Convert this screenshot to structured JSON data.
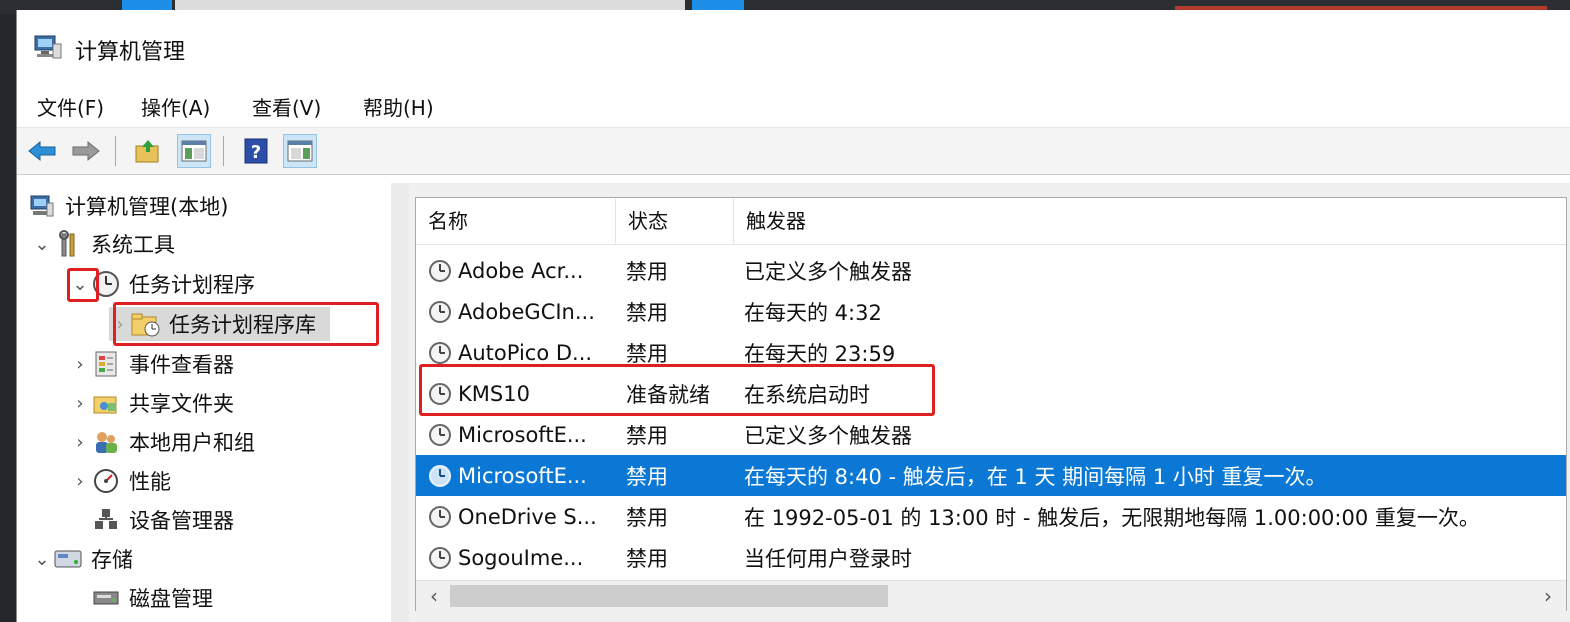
{
  "window": {
    "title": "计算机管理"
  },
  "menu": [
    "文件(F)",
    "操作(A)",
    "查看(V)",
    "帮助(H)"
  ],
  "toolbar": {
    "buttons": [
      "back-icon",
      "forward-icon",
      "up-folder-icon",
      "show-hide-console-tree-icon",
      "help-icon",
      "show-hide-action-pane-icon"
    ]
  },
  "tree": {
    "root": "计算机管理(本地)",
    "system_tools": "系统工具",
    "task_scheduler": "任务计划程序",
    "task_scheduler_library": "任务计划程序库",
    "event_viewer": "事件查看器",
    "shared_folders": "共享文件夹",
    "local_users_groups": "本地用户和组",
    "performance": "性能",
    "device_manager": "设备管理器",
    "storage": "存储",
    "disk_management": "磁盘管理"
  },
  "list": {
    "columns": [
      "名称",
      "状态",
      "触发器"
    ],
    "rows": [
      {
        "name": "Adobe Acr...",
        "status": "禁用",
        "trigger": "已定义多个触发器"
      },
      {
        "name": "AdobeGCIn...",
        "status": "禁用",
        "trigger": "在每天的 4:32"
      },
      {
        "name": "AutoPico D...",
        "status": "禁用",
        "trigger": "在每天的 23:59"
      },
      {
        "name": "KMS10",
        "status": "准备就绪",
        "trigger": "在系统启动时"
      },
      {
        "name": "MicrosoftE...",
        "status": "禁用",
        "trigger": "已定义多个触发器"
      },
      {
        "name": "MicrosoftE...",
        "status": "禁用",
        "trigger": "在每天的 8:40 - 触发后，在 1 天 期间每隔 1 小时 重复一次。"
      },
      {
        "name": "OneDrive S...",
        "status": "禁用",
        "trigger": "在 1992-05-01 的 13:00 时 - 触发后，无限期地每隔 1.00:00:00 重复一次。"
      },
      {
        "name": "SogouIme...",
        "status": "禁用",
        "trigger": "当任何用户登录时"
      }
    ],
    "selected_index": 5
  },
  "colors": {
    "selection": "#0a78d4",
    "highlight_box": "#e02020"
  }
}
